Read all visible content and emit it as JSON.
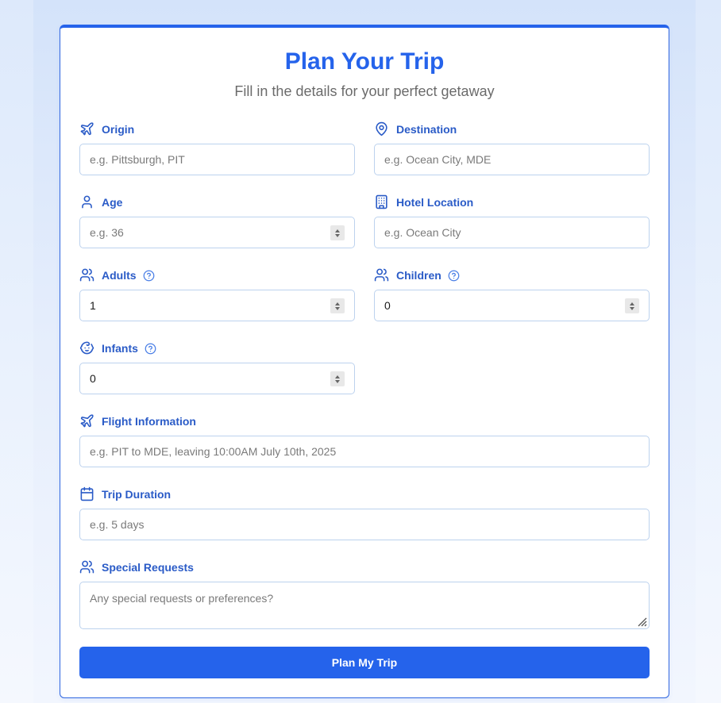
{
  "header": {
    "title": "Plan Your Trip",
    "subtitle": "Fill in the details for your perfect getaway"
  },
  "fields": {
    "origin": {
      "label": "Origin",
      "icon": "plane-icon",
      "placeholder": "e.g. Pittsburgh, PIT",
      "value": ""
    },
    "destination": {
      "label": "Destination",
      "icon": "map-pin-icon",
      "placeholder": "e.g. Ocean City, MDE",
      "value": ""
    },
    "age": {
      "label": "Age",
      "icon": "user-icon",
      "placeholder": "e.g. 36",
      "value": ""
    },
    "hotel_location": {
      "label": "Hotel Location",
      "icon": "building-icon",
      "placeholder": "e.g. Ocean City",
      "value": ""
    },
    "adults": {
      "label": "Adults",
      "icon": "users-icon",
      "value": "1",
      "has_help": true
    },
    "children": {
      "label": "Children",
      "icon": "users-icon",
      "value": "0",
      "has_help": true
    },
    "infants": {
      "label": "Infants",
      "icon": "baby-icon",
      "value": "0",
      "has_help": true
    },
    "flight_information": {
      "label": "Flight Information",
      "icon": "plane-icon",
      "placeholder": "e.g. PIT to MDE, leaving 10:00AM July 10th, 2025",
      "value": ""
    },
    "trip_duration": {
      "label": "Trip Duration",
      "icon": "calendar-icon",
      "placeholder": "e.g. 5 days",
      "value": ""
    },
    "special_requests": {
      "label": "Special Requests",
      "icon": "users-icon",
      "placeholder": "Any special requests or preferences?",
      "value": ""
    }
  },
  "submit": {
    "label": "Plan My Trip"
  },
  "colors": {
    "accent": "#2563eb",
    "label": "#2a5bc7",
    "input_border": "#bcd2ee",
    "placeholder": "#7a7a7a"
  }
}
